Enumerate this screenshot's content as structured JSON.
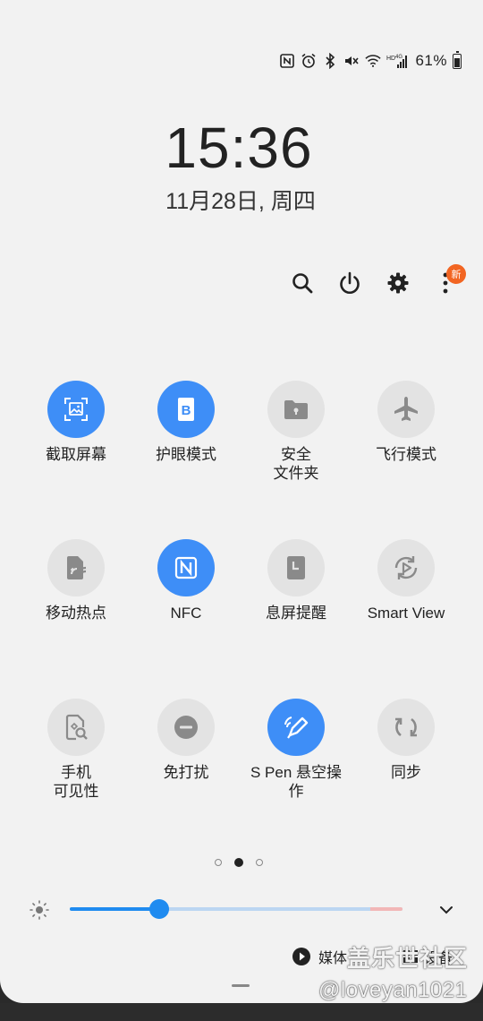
{
  "status_bar": {
    "icons": [
      "nfc-icon",
      "alarm-icon",
      "bluetooth-icon",
      "mute-icon",
      "wifi-icon",
      "hd-4g-signal-icon"
    ],
    "battery_percent": "61%",
    "battery_level": 0.61
  },
  "clock": {
    "time": "15:36",
    "date": "11月28日, 周四"
  },
  "toolbar": {
    "icons": [
      "search-icon",
      "power-icon",
      "settings-icon",
      "more-icon"
    ],
    "badge": "新"
  },
  "tiles": [
    {
      "label": "截取屏幕",
      "icon": "screenshot-icon",
      "on": true
    },
    {
      "label": "护眼模式",
      "icon": "eye-comfort-icon",
      "on": true
    },
    {
      "label": "安全\n文件夹",
      "icon": "secure-folder-icon",
      "on": false
    },
    {
      "label": "飞行模式",
      "icon": "airplane-icon",
      "on": false
    },
    {
      "label": "移动热点",
      "icon": "hotspot-icon",
      "on": false
    },
    {
      "label": "NFC",
      "icon": "nfc-icon",
      "on": true
    },
    {
      "label": "息屏提醒",
      "icon": "always-on-display-icon",
      "on": false
    },
    {
      "label": "Smart View",
      "icon": "smart-view-icon",
      "on": false
    },
    {
      "label": "手机\n可见性",
      "icon": "phone-visibility-icon",
      "on": false
    },
    {
      "label": "免打扰",
      "icon": "do-not-disturb-icon",
      "on": false
    },
    {
      "label": "S Pen 悬空操\n作",
      "icon": "s-pen-icon",
      "on": true
    },
    {
      "label": "同步",
      "icon": "sync-icon",
      "on": false
    }
  ],
  "pager": {
    "pages": 3,
    "active": 1
  },
  "brightness": {
    "level": 0.27
  },
  "media_output": {
    "media_label": "媒体",
    "device_label": "设备"
  },
  "watermark": {
    "line1": "盖乐世社区",
    "line2": "@loveyan1021"
  },
  "colors": {
    "accent": "#3e8ef7",
    "panel_bg": "#f2f2f2",
    "tile_off": "#e3e3e3",
    "badge": "#f26522"
  }
}
